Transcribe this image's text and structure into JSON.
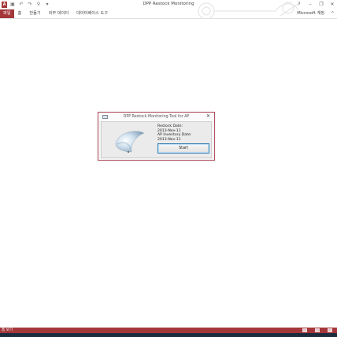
{
  "window": {
    "title": "DPP Restock Monitoring",
    "app_icon": "A"
  },
  "qat_icons": [
    "save-icon",
    "undo-icon",
    "redo-icon",
    "filter-icon",
    "customize-icon"
  ],
  "window_controls": {
    "help": "?",
    "minimize": "–",
    "restore": "❐",
    "close": "✕"
  },
  "ribbon": {
    "tabs": [
      "파일",
      "홈",
      "만들기",
      "외부 데이터",
      "데이터베이스 도구"
    ],
    "account": "Microsoft 계정",
    "collapse_glyph": "^"
  },
  "dialog": {
    "title": "DPP Restock Monitoring Tool for AP",
    "close_glyph": "✕",
    "restock_label": "Restock Date:",
    "restock_value": "2013-Nov-11",
    "inventory_label": "AP Inventory Date:",
    "inventory_value": "2013-Nov-11",
    "start_label": "Start"
  },
  "statusbar": {
    "text": "폼 보기"
  },
  "colors": {
    "accent": "#a4373a",
    "dialog_border": "#b34f60",
    "button_border": "#3c7fb1"
  }
}
